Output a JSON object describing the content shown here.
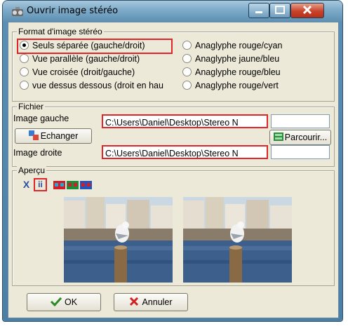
{
  "window": {
    "title": "Ouvrir image stéréo"
  },
  "format_group": {
    "legend": "Format d'image stéréo",
    "left_options": [
      {
        "label": "Seuls séparée (gauche/droit)",
        "selected": true
      },
      {
        "label": "Vue parallèle (gauche/droit)",
        "selected": false
      },
      {
        "label": "Vue croisée (droit/gauche)",
        "selected": false
      },
      {
        "label": "vue dessus dessous (droit en hau",
        "selected": false
      }
    ],
    "right_options": [
      {
        "label": "Anaglyphe rouge/cyan",
        "selected": false
      },
      {
        "label": "Anaglyphe jaune/bleu",
        "selected": false
      },
      {
        "label": "Anaglyphe rouge/bleu",
        "selected": false
      },
      {
        "label": "Anaglyphe rouge/vert",
        "selected": false
      }
    ]
  },
  "file_group": {
    "legend": "Fichier",
    "left_label": "Image gauche",
    "left_path": "C:\\Users\\Daniel\\Desktop\\Stereo N",
    "swap_button": "Echanger",
    "right_label": "Image droite",
    "right_path": "C:\\Users\\Daniel\\Desktop\\Stereo N",
    "browse_button": "Parcourir..."
  },
  "preview_group": {
    "legend": "Aperçu",
    "tools": [
      "cross-view-icon",
      "parallel-view-icon",
      "anaglyph-red-cyan-icon",
      "anaglyph-red-green-icon",
      "anaglyph-red-blue-icon"
    ]
  },
  "footer": {
    "ok_label": "OK",
    "cancel_label": "Annuler"
  },
  "colors": {
    "highlight": "#e0252b",
    "dialog_bg": "#ece9d8",
    "title_blue": "#7daac8"
  }
}
